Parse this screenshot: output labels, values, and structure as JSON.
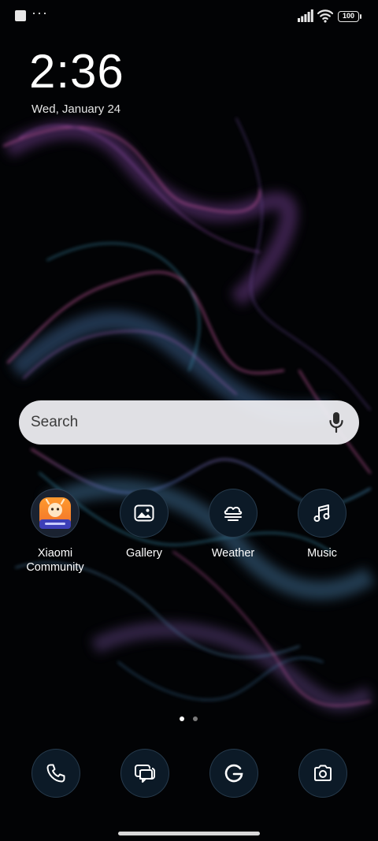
{
  "status_bar": {
    "dots": "···",
    "battery": "100"
  },
  "lock": {
    "time": "2:36",
    "date": "Wed, January 24"
  },
  "search": {
    "placeholder": "Search"
  },
  "apps": [
    {
      "label": "Xiaomi Community",
      "icon": "xiaomi-community-icon"
    },
    {
      "label": "Gallery",
      "icon": "gallery-icon"
    },
    {
      "label": "Weather",
      "icon": "weather-icon"
    },
    {
      "label": "Music",
      "icon": "music-icon"
    }
  ],
  "page_indicator": {
    "pages": 2,
    "current": 1
  },
  "dock": [
    {
      "icon": "phone-icon"
    },
    {
      "icon": "messages-icon"
    },
    {
      "icon": "google-icon"
    },
    {
      "icon": "camera-icon"
    }
  ],
  "colors": {
    "background": "#020305",
    "wallpaper_pink": "#c0569a",
    "wallpaper_teal": "#3a8fae",
    "icon_bg": "#0c1a27"
  }
}
